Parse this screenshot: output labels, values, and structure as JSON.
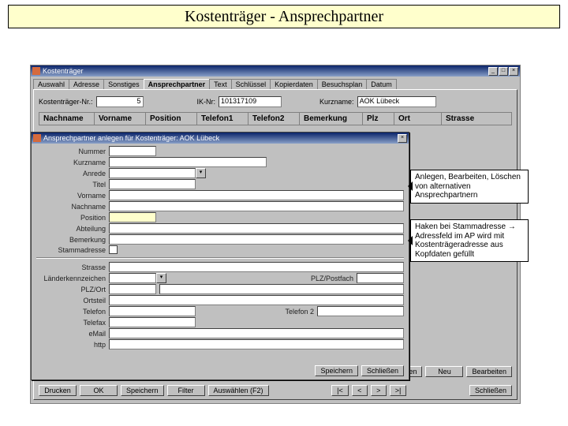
{
  "slide_title": "Kostenträger - Ansprechpartner",
  "main_window": {
    "title": "Kostenträger",
    "tabs": [
      "Auswahl",
      "Adresse",
      "Sonstiges",
      "Ansprechpartner",
      "Text",
      "Schlüssel",
      "Kopierdaten",
      "Besuchsplan",
      "Datum"
    ],
    "active_tab": 3,
    "top_fields": {
      "nr_label": "Kostenträger-Nr.:",
      "nr_value": "5",
      "ik_label": "IK-Nr:",
      "ik_value": "101317109",
      "kurz_label": "Kurzname:",
      "kurz_value": "AOK Lübeck"
    },
    "columns": [
      "Nachname",
      "Vorname",
      "Position",
      "Telefon1",
      "Telefon2",
      "Bemerkung",
      "Plz",
      "Ort",
      "Strasse"
    ],
    "bottom_buttons": {
      "drucken": "Drucken",
      "ok": "OK",
      "speichern": "Speichern",
      "filter": "Filter",
      "auswahl": "Auswählen (F2)",
      "first": "|<",
      "prev": "<",
      "next": ">",
      "last": ">|",
      "schliessen": "Schließen"
    },
    "list_buttons": {
      "loeschen": "Löschen",
      "neu": "Neu",
      "bearbeiten": "Bearbeiten"
    }
  },
  "dialog": {
    "title": "Ansprechpartner anlegen für Kostenträger: AOK Lübeck",
    "labels": {
      "nummer": "Nummer",
      "kurzname": "Kurzname",
      "anrede": "Anrede",
      "titel": "Titel",
      "vorname": "Vorname",
      "nachname": "Nachname",
      "position": "Position",
      "abteilung": "Abteilung",
      "bemerkung": "Bemerkung",
      "stammadresse": "Stammadresse",
      "strasse": "Strasse",
      "lkz": "Länderkennzeichen",
      "plzpost": "PLZ/Postfach",
      "plzort": "PLZ/Ort",
      "ortsteil": "Ortsteil",
      "telefon": "Telefon",
      "telefon2": "Telefon 2",
      "telefax": "Telefax",
      "email": "eMail",
      "http": "http"
    },
    "buttons": {
      "speichern": "Speichern",
      "schliessen": "Schließen"
    }
  },
  "callouts": {
    "c1": "Anlegen, Bearbeiten, Löschen von alternativen Ansprechpartnern",
    "c2": "Haken bei Stammadresse → Adressfeld im AP wird mit Kostenträgeradresse aus Kopfdaten gefüllt"
  }
}
